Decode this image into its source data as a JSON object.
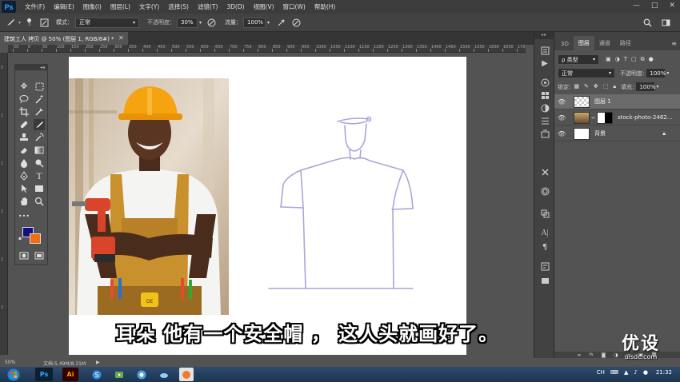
{
  "app": {
    "logo": "Ps"
  },
  "menu": [
    "文件(F)",
    "编辑(E)",
    "图像(I)",
    "图层(L)",
    "文字(Y)",
    "选择(S)",
    "滤镜(T)",
    "3D(D)",
    "视图(V)",
    "窗口(W)",
    "帮助(H)"
  ],
  "window_controls": {
    "minimize": "—",
    "maximize": "□",
    "close": "✕"
  },
  "options": {
    "brush_size": "3",
    "mode_label": "模式：",
    "mode_value": "正常",
    "opacity_label": "不透明度：",
    "opacity_value": "30%",
    "flow_label": "流量：",
    "flow_value": "100%"
  },
  "document": {
    "tab_title": "建筑工人 拷贝 @ 50% (图层 1, RGB/8#) *",
    "close": "✕"
  },
  "ruler_top": [
    "50",
    "0",
    "50",
    "100",
    "150",
    "200",
    "250",
    "300",
    "350",
    "400",
    "450",
    "500",
    "550",
    "600",
    "650",
    "700",
    "750",
    "800",
    "850",
    "900",
    "950",
    "1000",
    "1050",
    "1100",
    "1150",
    "1200",
    "1250",
    "1300",
    "1350",
    "1400",
    "1450",
    "1500",
    "1550",
    "1600",
    "1650",
    "1700",
    "1750"
  ],
  "subtitle": "耳朵  他有一个安全帽  ，  这人头就画好了。",
  "status": {
    "zoom": "50%",
    "doc_size": "文档:5.49M/8.31M",
    "arrow": "▶"
  },
  "panels": {
    "tabs": [
      "3D",
      "图层",
      "通道",
      "路径"
    ],
    "filter_label": "ρ 类型",
    "blend_mode": "正常",
    "opacity_label": "不透明度:",
    "opacity_value": "100%",
    "lock_label": "锁定:",
    "fill_label": "填充:",
    "fill_value": "100%",
    "layers": [
      {
        "name": "图层 1",
        "selected": true
      },
      {
        "name": "stock-photo-2462...",
        "selected": false
      },
      {
        "name": "背景",
        "selected": false
      }
    ]
  },
  "taskbar": {
    "time": "21:32",
    "ime": "CH"
  },
  "watermark": {
    "main": "优设",
    "sub": "uisdc.com"
  },
  "colors": {
    "foreground": "#13117e",
    "background": "#f36b12",
    "sketch": "#a9a6d8",
    "helmet": "#f5a30e"
  }
}
